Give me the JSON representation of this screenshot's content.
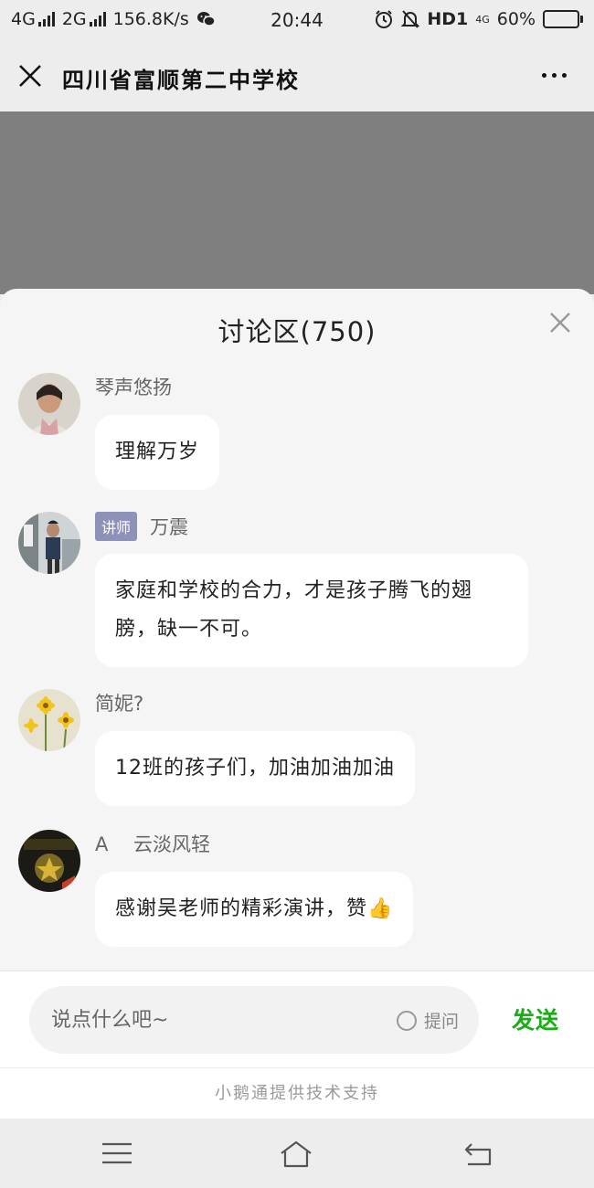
{
  "status_bar": {
    "network1": "4G",
    "network2": "2G",
    "speed": "156.8K/s",
    "time": "20:44",
    "hd": "HD1",
    "net_small": "4G",
    "battery": "60%",
    "battery_level": 0.6
  },
  "nav": {
    "title": "四川省富顺第二中学校"
  },
  "discussion": {
    "title": "讨论区(750)",
    "comments": [
      {
        "name": "琴声悠扬",
        "badge": "",
        "text": "理解万岁"
      },
      {
        "name": "万震",
        "badge": "讲师",
        "text": "家庭和学校的合力，才是孩子腾飞的翅膀，缺一不可。"
      },
      {
        "name": "简妮?",
        "badge": "",
        "text": "12班的孩子们，加油加油加油"
      },
      {
        "name": "A　 云淡风轻",
        "badge": "",
        "text": "感谢吴老师的精彩演讲，赞👍"
      }
    ]
  },
  "input": {
    "placeholder": "说点什么吧~",
    "ask_label": "提问",
    "send_label": "发送"
  },
  "footer": {
    "text": "小鹅通提供技术支持"
  },
  "colors": {
    "send": "#1aad19",
    "badge": "#8f92b8",
    "overlay": "#7f7f7f"
  }
}
